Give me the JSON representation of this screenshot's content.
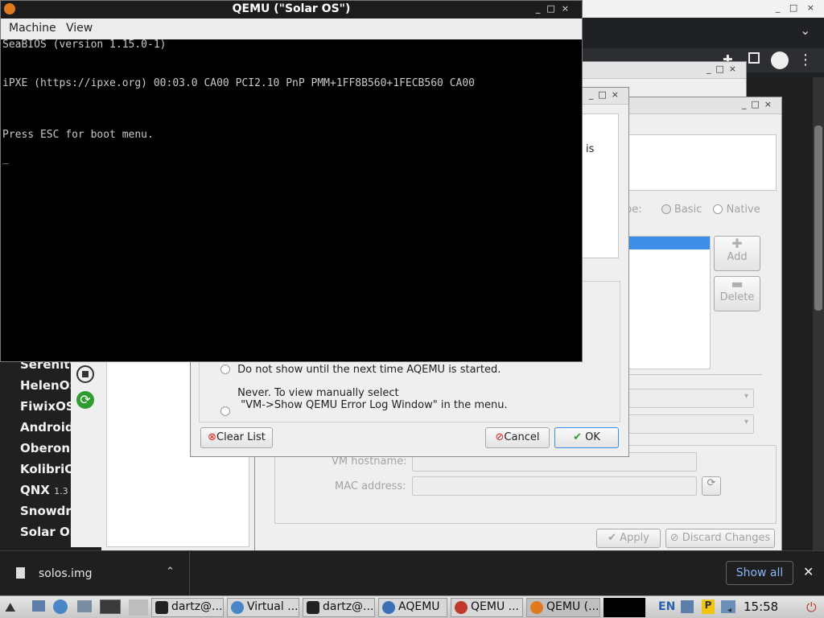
{
  "right_chrome": {
    "title_buttons": "_ □ ×"
  },
  "sidebar_vms": [
    "Serenity",
    "HelenOS",
    "FiwixOS",
    "Android",
    "Oberon",
    "KolibriO",
    "QNX",
    "Snowdr",
    "Solar OS"
  ],
  "sidebar_vms_extra": {
    "qnx_version": "1.3"
  },
  "settings": {
    "type_label": "pe:",
    "basic_label": "Basic",
    "native_label": "Native",
    "add_label": "Add",
    "delete_label": "Delete",
    "vm_hostname_label": "VM hostname:",
    "mac_address_label": "MAC address:",
    "apply_label": "Apply",
    "discard_label": "Discard Changes"
  },
  "error_dialog": {
    "partial_text_1": "is",
    "option_1": "Do not show until the next time AQEMU is started.",
    "option_2_line1": "Never. To view manually select",
    "option_2_line2": "\"VM->Show QEMU Error Log Window\" in the menu.",
    "clear_list_label": "Clear List",
    "cancel_label": "Cancel",
    "ok_label": "OK"
  },
  "qemu": {
    "title": "QEMU (\"Solar OS\")",
    "menu": [
      "Machine",
      "View"
    ],
    "console_lines": [
      "SeaBIOS (version 1.15.0-1)",
      "",
      "iPXE (https://ipxe.org) 00:03.0 CA00 PCI2.10 PnP PMM+1FF8B560+1FECB560 CA00",
      "",
      "",
      "Press ESC for boot menu.",
      "",
      "_"
    ]
  },
  "download_bar": {
    "file": "solos.img",
    "show_all": "Show all"
  },
  "taskbar": {
    "tasks": [
      "dartz@...",
      "Virtual ...",
      "dartz@...",
      "AQEMU",
      "QEMU ...",
      "QEMU (..."
    ],
    "lang": "EN",
    "clock": "15:58"
  },
  "colors": {
    "accent": "#3d8ee6",
    "terminal_bg": "#000000",
    "desktop": "#1b1b1b"
  }
}
